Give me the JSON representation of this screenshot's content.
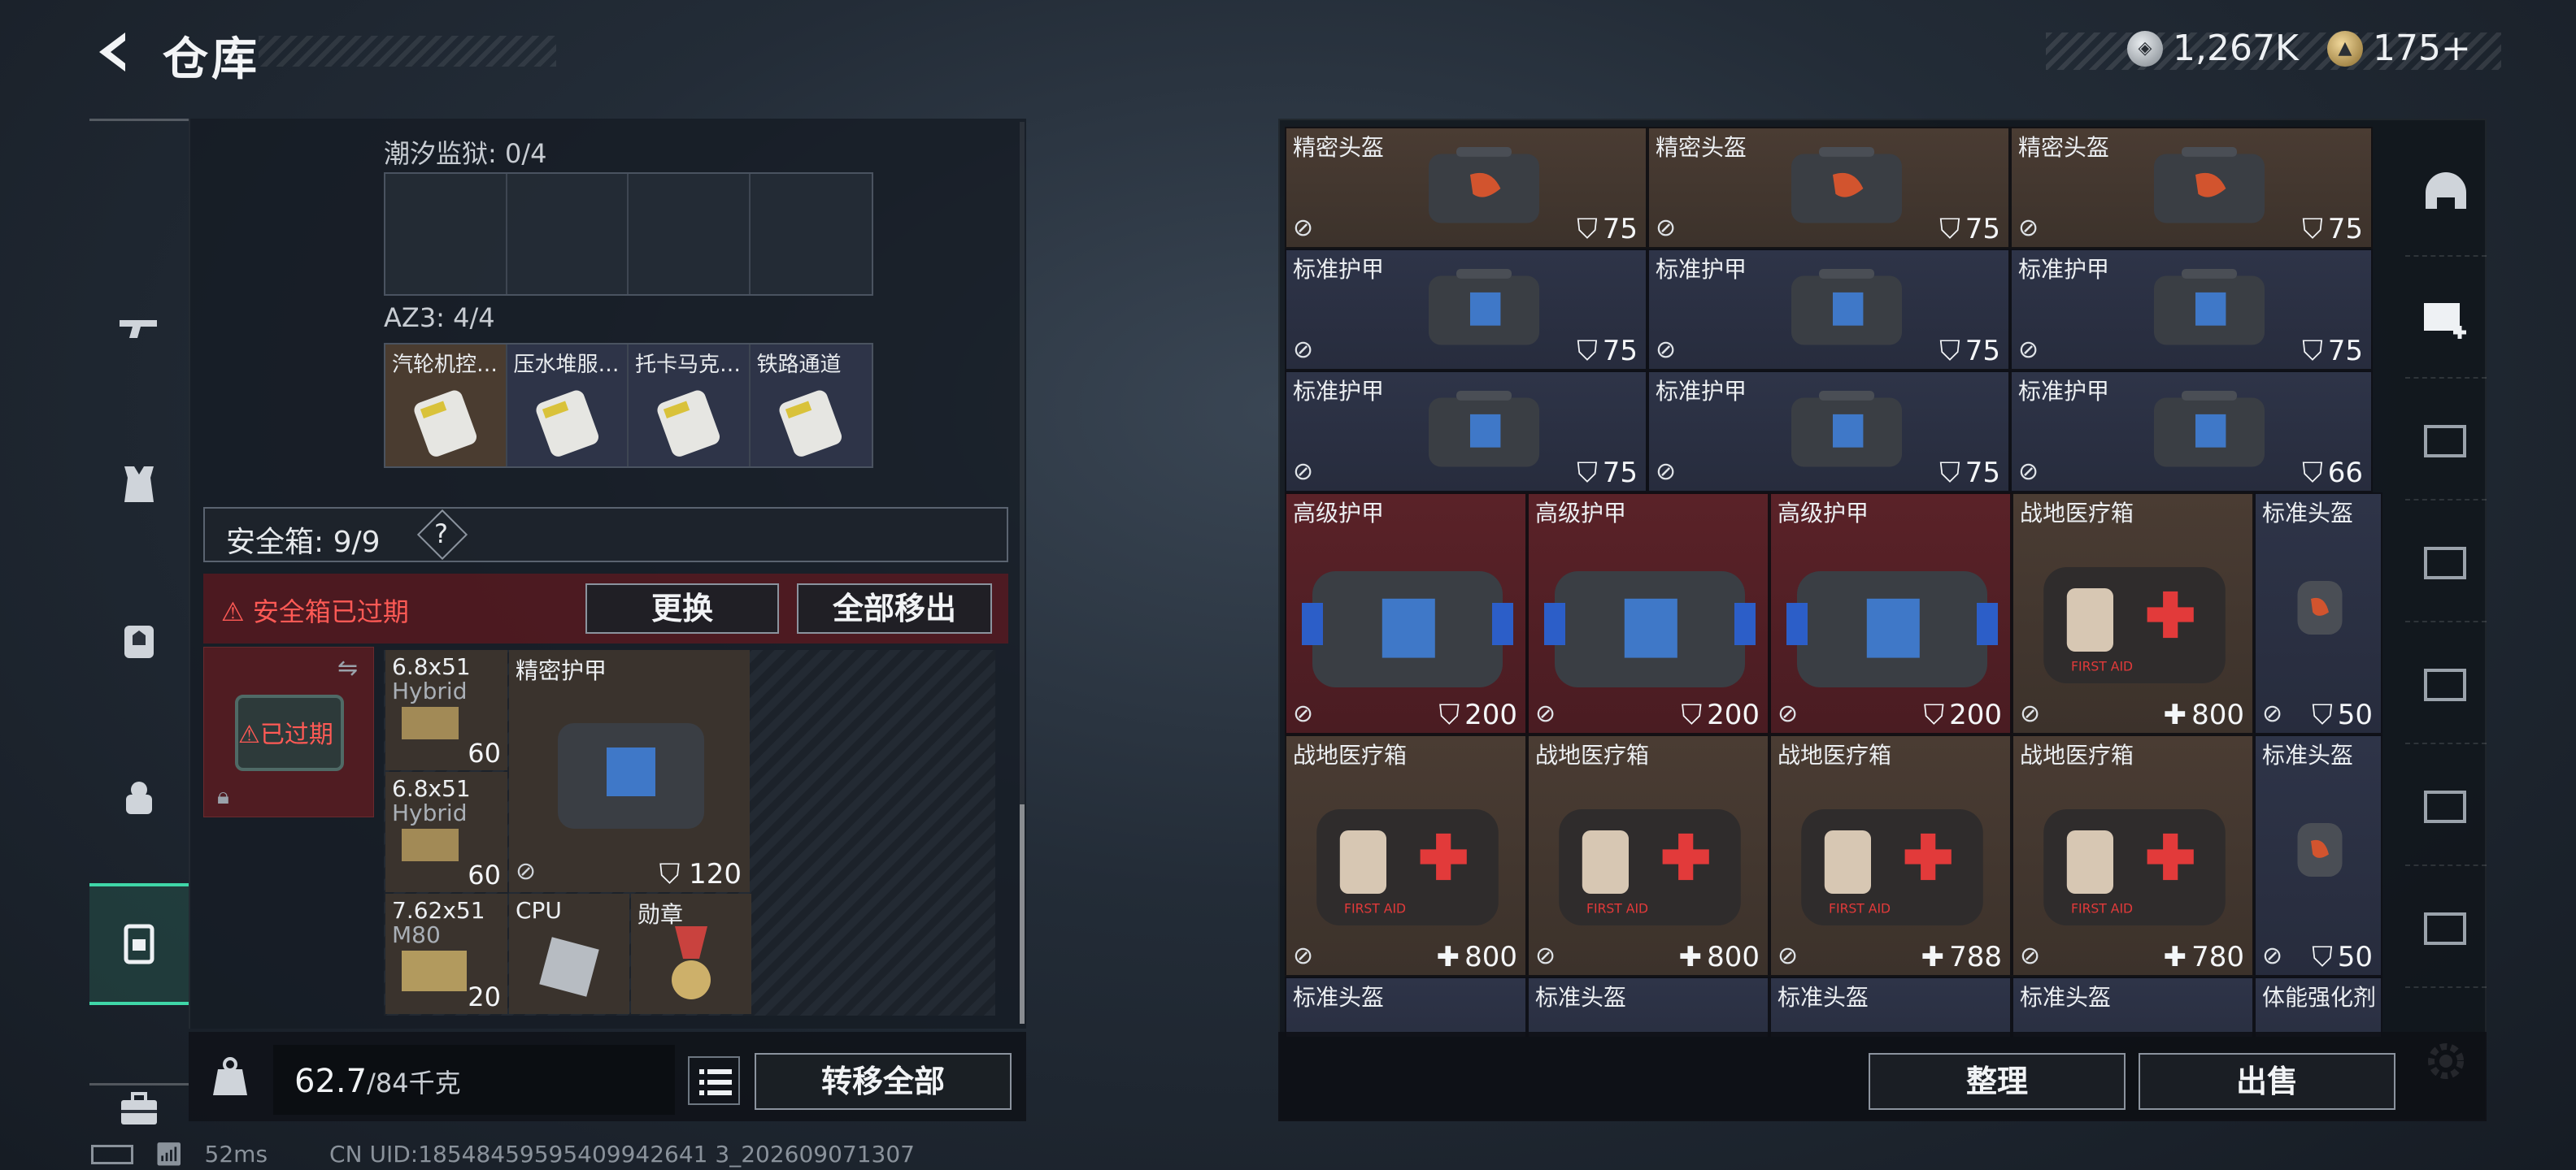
{
  "header": {
    "title": "仓库",
    "currency_silver": "1,267K",
    "currency_gold": "175+"
  },
  "left_nav": [
    "gun-icon",
    "armor-icon",
    "backpack-icon",
    "rig-icon",
    "safebox-icon",
    "toolbox-icon"
  ],
  "left": {
    "tidal_prison_label": "潮汐监狱: 0/4",
    "az3_label": "AZ3: 4/4",
    "az3_items": [
      "汽轮机控…",
      "压水堆服…",
      "托卡马克…",
      "铁路通道"
    ],
    "safebox_label": "安全箱: 9/9",
    "safebox_help": "?",
    "expired_warning": "安全箱已过期",
    "replace_button": "更换",
    "remove_all_button": "全部移出",
    "expired_badge": "已过期",
    "safe_items": [
      {
        "name": "6.8x51",
        "sub": "Hybrid",
        "count": "60"
      },
      {
        "name": "6.8x51",
        "sub": "Hybrid",
        "count": "60"
      },
      {
        "name": "7.62x51",
        "sub": "M80",
        "count": "20"
      }
    ],
    "safe_armor_name": "精密护甲",
    "safe_armor_value": "120",
    "cpu_label": "CPU",
    "medal_label": "勋章",
    "weight_value": "62.7",
    "weight_cap": "/84千克",
    "transfer_all_button": "转移全部"
  },
  "right": {
    "rows": [
      {
        "cells": [
          {
            "name": "精密头盔",
            "value": "75",
            "kind": "shield"
          },
          {
            "name": "精密头盔",
            "value": "75",
            "kind": "shield"
          },
          {
            "name": "精密头盔",
            "value": "75",
            "kind": "shield"
          }
        ]
      },
      {
        "cells": [
          {
            "name": "标准护甲",
            "value": "75",
            "kind": "shield"
          },
          {
            "name": "标准护甲",
            "value": "75",
            "kind": "shield"
          },
          {
            "name": "标准护甲",
            "value": "75",
            "kind": "shield"
          }
        ]
      },
      {
        "cells": [
          {
            "name": "标准护甲",
            "value": "75",
            "kind": "shield"
          },
          {
            "name": "标准护甲",
            "value": "75",
            "kind": "shield"
          },
          {
            "name": "标准护甲",
            "value": "66",
            "kind": "shield"
          }
        ]
      }
    ],
    "big_row1": [
      {
        "name": "高级护甲",
        "value": "200"
      },
      {
        "name": "高级护甲",
        "value": "200"
      },
      {
        "name": "高级护甲",
        "value": "200"
      },
      {
        "name": "战地医疗箱",
        "value": "800"
      },
      {
        "name": "标准头盔",
        "value": "50"
      }
    ],
    "big_row2": [
      {
        "name": "战地医疗箱",
        "value": "800"
      },
      {
        "name": "战地医疗箱",
        "value": "800"
      },
      {
        "name": "战地医疗箱",
        "value": "788"
      },
      {
        "name": "战地医疗箱",
        "value": "780"
      },
      {
        "name": "标准头盔",
        "value": "50"
      }
    ],
    "partial_row": [
      "标准头盔",
      "标准头盔",
      "标准头盔",
      "标准头盔",
      "体能强化剂"
    ],
    "sort_button": "整理",
    "sell_button": "出售"
  },
  "status": {
    "ping": "52ms",
    "uid": "CN UID:18548459595409942641 3_202609071307"
  },
  "colors": {
    "accent": "#3fd7a8",
    "warning": "#ff5a55"
  }
}
